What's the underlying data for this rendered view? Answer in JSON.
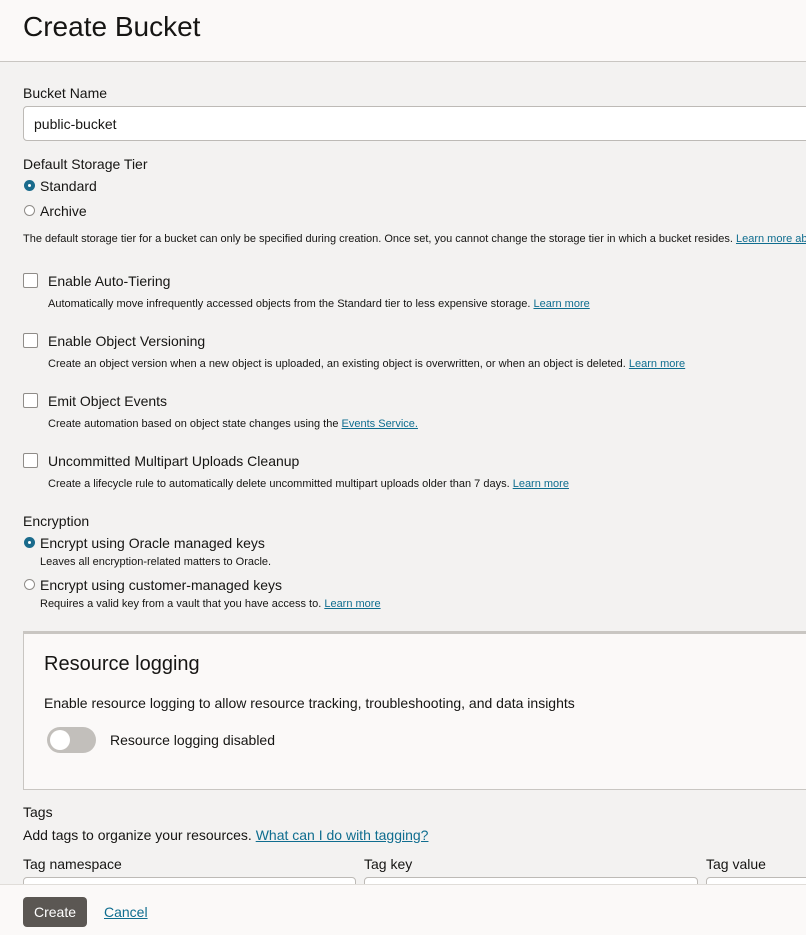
{
  "page": {
    "title": "Create Bucket"
  },
  "bucket_name": {
    "label": "Bucket Name",
    "value": "public-bucket"
  },
  "storage_tier": {
    "label": "Default Storage Tier",
    "options": [
      {
        "label": "Standard",
        "selected": true
      },
      {
        "label": "Archive",
        "selected": false
      }
    ],
    "help": "The default storage tier for a bucket can only be specified during creation. Once set, you cannot change the storage tier in which a bucket resides.",
    "help_link": "Learn more ab"
  },
  "checkboxes": [
    {
      "label": "Enable Auto-Tiering",
      "checked": false,
      "description": "Automatically move infrequently accessed objects from the Standard tier to less expensive storage.",
      "link": "Learn more"
    },
    {
      "label": "Enable Object Versioning",
      "checked": false,
      "description": "Create an object version when a new object is uploaded, an existing object is overwritten, or when an object is deleted.",
      "link": "Learn more"
    },
    {
      "label": "Emit Object Events",
      "checked": false,
      "description": "Create automation based on object state changes using the",
      "link": "Events Service."
    },
    {
      "label": "Uncommitted Multipart Uploads Cleanup",
      "checked": false,
      "description": "Create a lifecycle rule to automatically delete uncommitted multipart uploads older than 7 days.",
      "link": "Learn more"
    }
  ],
  "encryption": {
    "label": "Encryption",
    "options": [
      {
        "label": "Encrypt using Oracle managed keys",
        "selected": true,
        "description": "Leaves all encryption-related matters to Oracle.",
        "link": ""
      },
      {
        "label": "Encrypt using customer-managed keys",
        "selected": false,
        "description": "Requires a valid key from a vault that you have access to.",
        "link": "Learn more"
      }
    ]
  },
  "resource_logging": {
    "title": "Resource logging",
    "description": "Enable resource logging to allow resource tracking, troubleshooting, and data insights",
    "toggle_label": "Resource logging disabled",
    "enabled": false
  },
  "tags": {
    "label": "Tags",
    "description": "Add tags to organize your resources.",
    "link": "What can I do with tagging?",
    "columns": [
      "Tag namespace",
      "Tag key",
      "Tag value"
    ]
  },
  "footer": {
    "create_label": "Create",
    "cancel_label": "Cancel"
  },
  "colors": {
    "accent": "#1a6b8c",
    "link": "#0f6d8f",
    "primary_button": "#5b5753",
    "background": "#f3f2f1"
  }
}
